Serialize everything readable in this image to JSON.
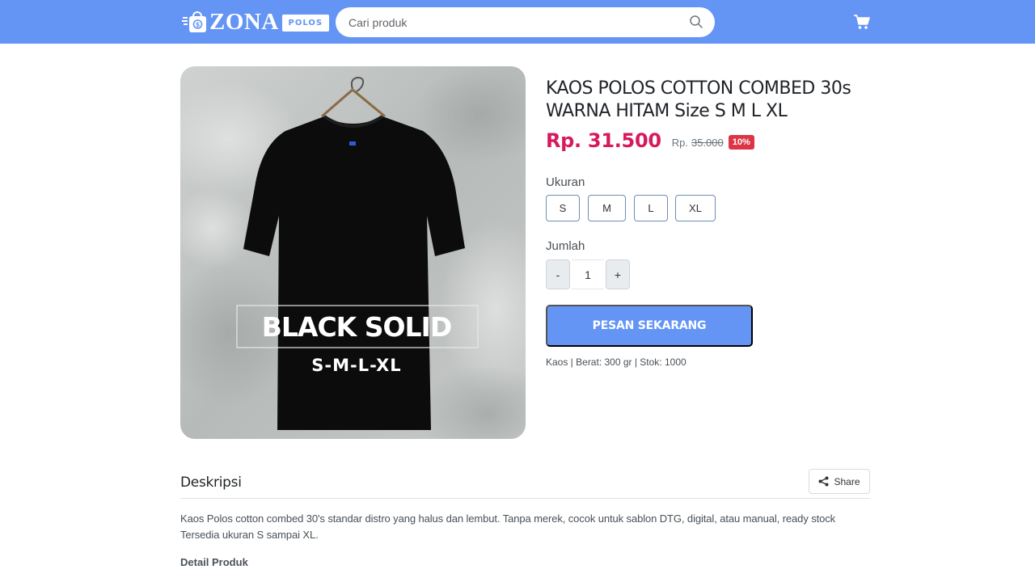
{
  "brand": {
    "name": "ZONA",
    "badge": "POLOS"
  },
  "search": {
    "placeholder": "Cari produk"
  },
  "product": {
    "title": "KAOS POLOS COTTON COMBED 30s WARNA HITAM Size S M L XL",
    "price": "Rp. 31.500",
    "original_label": "Rp.",
    "original_price": "35.000",
    "discount": "10%",
    "image": {
      "overlay_title": "BLACK SOLID",
      "overlay_sizes": "S-M-L-XL"
    },
    "size_label": "Ukuran",
    "sizes": [
      "S",
      "M",
      "L",
      "XL"
    ],
    "qty_label": "Jumlah",
    "qty_minus": "-",
    "qty_value": "1",
    "qty_plus": "+",
    "order_button": "PESAN SEKARANG",
    "meta": "Kaos | Berat: 300 gr | Stok: 1000"
  },
  "description": {
    "heading": "Deskripsi",
    "share_label": "Share",
    "text": "Kaos Polos cotton combed 30's standar distro yang halus dan lembut. Tanpa merek, cocok untuk sablon DTG, digital, atau manual, ready stock Tersedia ukuran S sampai XL.",
    "detail_heading": "Detail Produk"
  },
  "colors": {
    "primary": "#6495f5",
    "price": "#d7195d",
    "discount": "#dc3545"
  }
}
